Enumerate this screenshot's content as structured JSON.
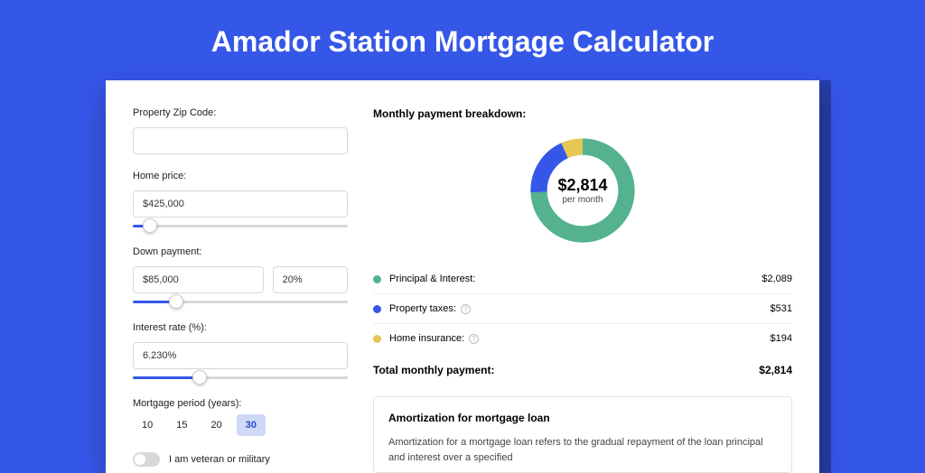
{
  "title": "Amador Station Mortgage Calculator",
  "form": {
    "zip_label": "Property Zip Code:",
    "zip_value": "",
    "price_label": "Home price:",
    "price_value": "$425,000",
    "price_slider_pct": 8,
    "down_label": "Down payment:",
    "down_value": "$85,000",
    "down_pct_value": "20%",
    "down_slider_pct": 20,
    "rate_label": "Interest rate (%):",
    "rate_value": "6.230%",
    "rate_slider_pct": 31,
    "period_label": "Mortgage period (years):",
    "period_options": [
      "10",
      "15",
      "20",
      "30"
    ],
    "period_selected": "30",
    "veteran_label": "I am veteran or military",
    "veteran_on": false
  },
  "breakdown": {
    "title": "Monthly payment breakdown:",
    "center_amount": "$2,814",
    "center_sub": "per month",
    "items": [
      {
        "name": "Principal & Interest:",
        "value": "$2,089",
        "color": "g",
        "info": false
      },
      {
        "name": "Property taxes:",
        "value": "$531",
        "color": "b",
        "info": true
      },
      {
        "name": "Home insurance:",
        "value": "$194",
        "color": "y",
        "info": true
      }
    ],
    "total_label": "Total monthly payment:",
    "total_value": "$2,814"
  },
  "amort": {
    "title": "Amortization for mortgage loan",
    "text": "Amortization for a mortgage loan refers to the gradual repayment of the loan principal and interest over a specified"
  },
  "chart_data": {
    "type": "pie",
    "title": "Monthly payment breakdown",
    "series": [
      {
        "name": "Principal & Interest",
        "value": 2089,
        "color": "#54b28f"
      },
      {
        "name": "Property taxes",
        "value": 531,
        "color": "#3557e8"
      },
      {
        "name": "Home insurance",
        "value": 194,
        "color": "#e6c756"
      }
    ],
    "total": 2814,
    "unit": "USD per month"
  }
}
